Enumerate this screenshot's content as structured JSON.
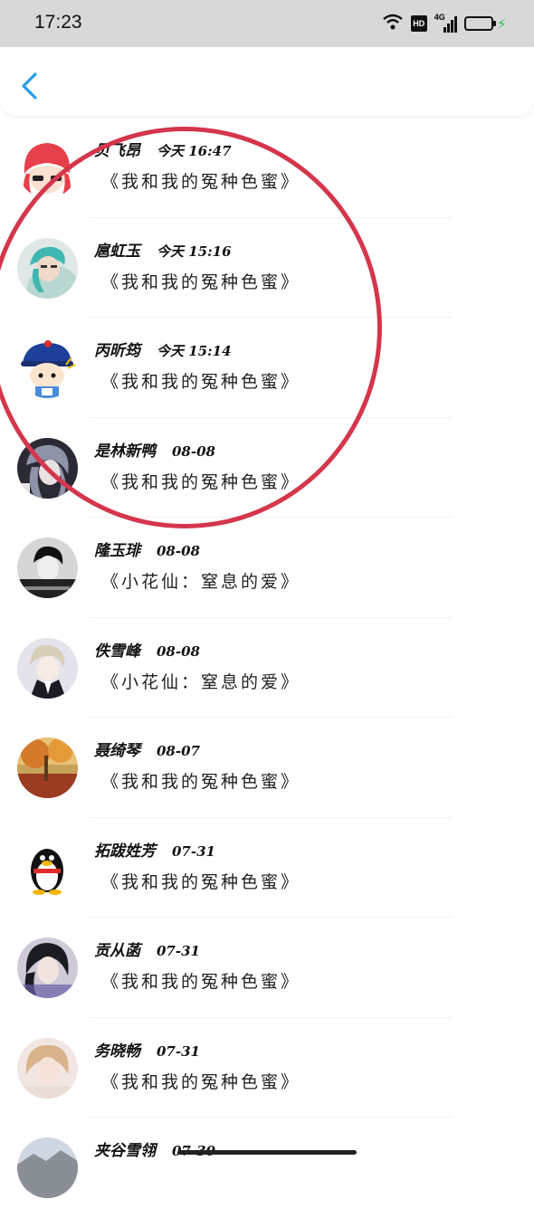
{
  "status_bar": {
    "time": "17:23",
    "hd_label": "HD",
    "network_label": "4G",
    "battery_color": "#27c24c"
  },
  "header": {
    "back_icon": "chevron-left-icon",
    "accent": "#2a9bea"
  },
  "highlight_color": "#d4364c",
  "conversations": [
    {
      "name": "贝飞昂",
      "time": "今天 16:47",
      "message": "《我和我的冤种色蜜》",
      "avatar": "red-hair-girl"
    },
    {
      "name": "扈虹玉",
      "time": "今天 15:16",
      "message": "《我和我的冤种色蜜》",
      "avatar": "teal-hair-person"
    },
    {
      "name": "丙昕筠",
      "time": "今天 15:14",
      "message": "《我和我的冤种色蜜》",
      "avatar": "cartoon-qing-official"
    },
    {
      "name": "是林新鸭",
      "time": "08-08",
      "message": "《我和我的冤种色蜜》",
      "avatar": "anime-grey-hair"
    },
    {
      "name": "隆玉琲",
      "time": "08-08",
      "message": "《小花仙：窒息的爱》",
      "avatar": "bw-boy"
    },
    {
      "name": "佚雪峰",
      "time": "08-08",
      "message": "《小花仙：窒息的爱》",
      "avatar": "anime-suit-boy"
    },
    {
      "name": "聂绮琴",
      "time": "08-07",
      "message": "《我和我的冤种色蜜》",
      "avatar": "autumn-tree"
    },
    {
      "name": "拓跋姓芳",
      "time": "07-31",
      "message": "《我和我的冤种色蜜》",
      "avatar": "penguin"
    },
    {
      "name": "贡从菡",
      "time": "07-31",
      "message": "《我和我的冤种色蜜》",
      "avatar": "dark-hair-girl"
    },
    {
      "name": "务晓畅",
      "time": "07-31",
      "message": "《我和我的冤种色蜜》",
      "avatar": "blonde-girl"
    },
    {
      "name": "夹谷雪翎",
      "time": "07-30",
      "message": "",
      "avatar": "landscape"
    }
  ]
}
